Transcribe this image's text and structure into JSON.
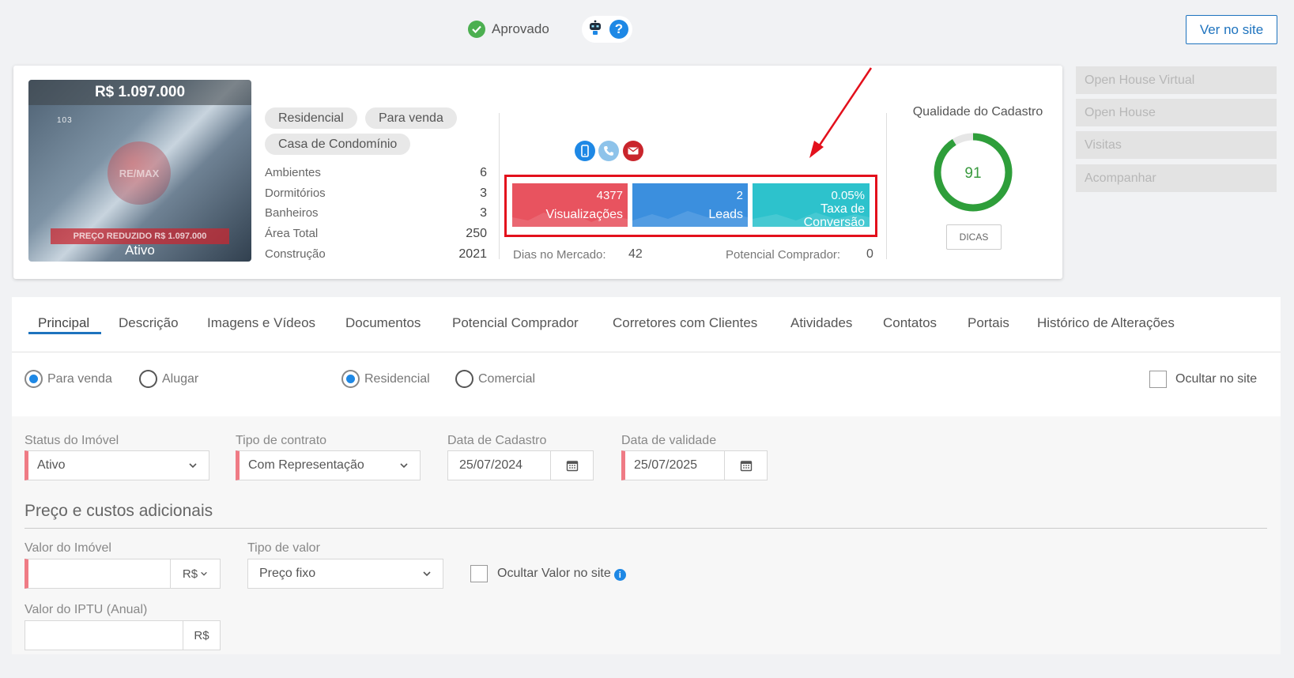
{
  "header": {
    "status_label": "Aprovado",
    "ver_no_site_label": "Ver no site"
  },
  "property": {
    "photo_price": "R$ 1.097.000",
    "photo_number": "103",
    "photo_watermark": "RE/MAX",
    "photo_banner": "PREÇO REDUZIDO  R$ 1.097.000",
    "photo_status": "Ativo",
    "tags": [
      "Residencial",
      "Para venda",
      "Casa de Condomínio"
    ],
    "features": [
      {
        "label": "Ambientes",
        "value": "6"
      },
      {
        "label": "Dormitórios",
        "value": "3"
      },
      {
        "label": "Banheiros",
        "value": "3"
      },
      {
        "label": "Área Total",
        "value": "250"
      },
      {
        "label": "Construção",
        "value": "2021"
      }
    ]
  },
  "stats": {
    "views_value": "4377",
    "views_label": "Visualizações",
    "leads_value": "2",
    "leads_label": "Leads",
    "conversion_value": "0.05%",
    "conversion_label": "Taxa de Conversão",
    "colors": {
      "views": "#e8535f",
      "leads": "#3b8fde",
      "conversion": "#2dc2cc",
      "highlight": "#e3101c"
    },
    "dias_label": "Dias no Mercado:",
    "dias_value": "42",
    "potencial_label": "Potencial Comprador:",
    "potencial_value": "0"
  },
  "quality": {
    "title": "Qualidade do Cadastro",
    "score": "91",
    "score_fraction": 0.91,
    "ring_color": "#2e9e3a",
    "dicas_label": "DICAS"
  },
  "side_actions": [
    "Open House Virtual",
    "Open House",
    "Visitas",
    "Acompanhar"
  ],
  "tabs": [
    "Principal",
    "Descrição",
    "Imagens e Vídeos",
    "Documentos",
    "Potencial Comprador",
    "Corretores com Clientes",
    "Atividades",
    "Contatos",
    "Portais",
    "Histórico de Alterações"
  ],
  "options": {
    "para_venda": "Para venda",
    "alugar": "Alugar",
    "residencial": "Residencial",
    "comercial": "Comercial",
    "ocultar_site": "Ocultar no site"
  },
  "form": {
    "status_label": "Status do Imóvel",
    "status_value": "Ativo",
    "contrato_label": "Tipo de contrato",
    "contrato_value": "Com Representação",
    "cadastro_label": "Data de Cadastro",
    "cadastro_value": "25/07/2024",
    "validade_label": "Data de validade",
    "validade_value": "25/07/2025",
    "section_title": "Preço e custos adicionais",
    "valor_label": "Valor do Imóvel",
    "valor_value": "",
    "currency": "R$",
    "tipo_valor_label": "Tipo de valor",
    "tipo_valor_value": "Preço fixo",
    "ocultar_valor_label": "Ocultar Valor no site",
    "iptu_label": "Valor do IPTU (Anual)",
    "iptu_value": "",
    "iptu_currency": "R$"
  }
}
